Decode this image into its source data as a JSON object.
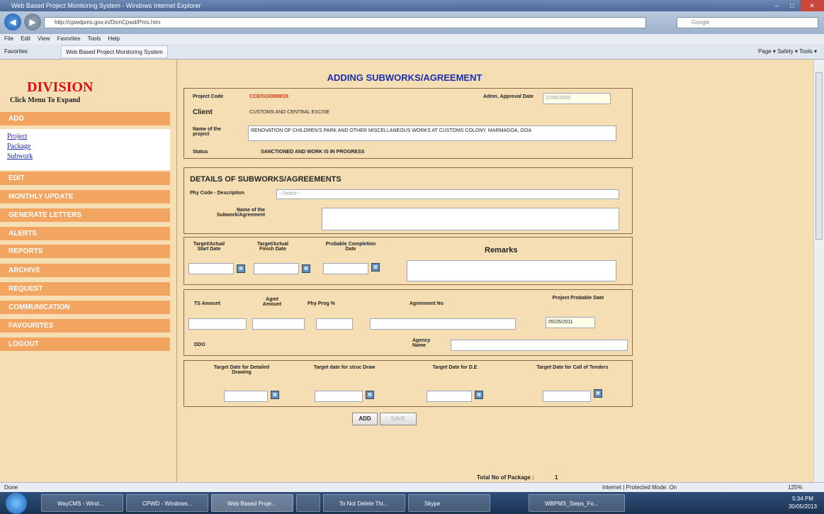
{
  "browser": {
    "title": "Web Based Project Monitoring System - Windows Internet Explorer",
    "url": "http://cpwdpms.gov.in/DivnCpwd/Pms.htm",
    "search_placeholder": "Google",
    "menu": [
      "File",
      "Edit",
      "View",
      "Favorites",
      "Tools",
      "Help"
    ],
    "favorites_label": "Favorites",
    "tab_label": "Web Based Project Monitoring System",
    "commands": "Page ▾  Safety ▾  Tools ▾",
    "status_left": "Done",
    "status_right": "Internet | Protected Mode: On",
    "zoom": "125%"
  },
  "sidebar": {
    "title": "DIVISION",
    "hint": "Click Menu To Expand",
    "menu": [
      "ADD",
      "EDIT",
      "MONTHLY UPDATE",
      "GENERATE LETTERS",
      "ALERTS",
      "REPORTS",
      "ARCHIVE",
      "REQUEST",
      "COMMUNICATION",
      "FAVOURITES",
      "LOGOUT"
    ],
    "submenu": [
      "Project",
      "Package",
      "Subwork"
    ]
  },
  "form": {
    "page_title": "ADDING SUBWORKS/AGREEMENT",
    "project": {
      "code_label": "Project Code",
      "code_value": "CCE/GO/3009/19",
      "approval_label": "Admn. Approval Date",
      "approval_value": "27/06/2009",
      "client_label": "Client",
      "client_value": "CUSTOMS AND CENTRAL EXCISE",
      "name_label": "Name of the project",
      "name_value": "RENOVATION OF CHILDREN'S PARK AND OTHER MISCELLANEOUS WORKS AT CUSTOMS COLONY, MARMAGOA, GOA",
      "status_label": "Status",
      "status_value": "SANCTIONED AND WORK IS IN PROGRESS"
    },
    "details": {
      "heading": "DETAILS OF SUBWORKS/AGREEMENTS",
      "phy_code_label": "Phy Code - Description",
      "phy_code_value": "--Select--",
      "subwork_name_label": "Name of the Subwork/Agreement",
      "subwork_name_value": ""
    },
    "dates": {
      "start_label": "Target/Actual Start Date",
      "finish_label": "Target/Actual Finish Date",
      "probable_label": "Probable Completion Date",
      "remarks_label": "Remarks"
    },
    "amounts": {
      "ts_label": "TS Amount",
      "agmt_label": "Agmt Amount",
      "phy_prog_label": "Phy Prog %",
      "agreement_no_label": "Agreement No",
      "project_probable_label": "Project Probable Date",
      "project_probable_value": "05/25/2011",
      "ddo_label": "DDO",
      "agency_label": "Agency Name"
    },
    "targets": {
      "drawing_label": "Target Date for Detailed Drawing",
      "struc_label": "Target date for struc Draw",
      "de_label": "Target Date for D.E",
      "tenders_label": "Target Date for Call of Tenders"
    },
    "buttons": {
      "add": "ADD",
      "save": "SAVE"
    },
    "footer_label": "Total No of Package :",
    "footer_value": "1"
  },
  "taskbar": {
    "items": [
      "WayCMS - Wind...",
      "CPWD - Windows...",
      "Web Based Proje...",
      "",
      "To Not Delete Thi...",
      "Skype",
      "WBPMS_Steps_Fo..."
    ],
    "time": "5:34 PM",
    "date": "30/05/2013"
  }
}
